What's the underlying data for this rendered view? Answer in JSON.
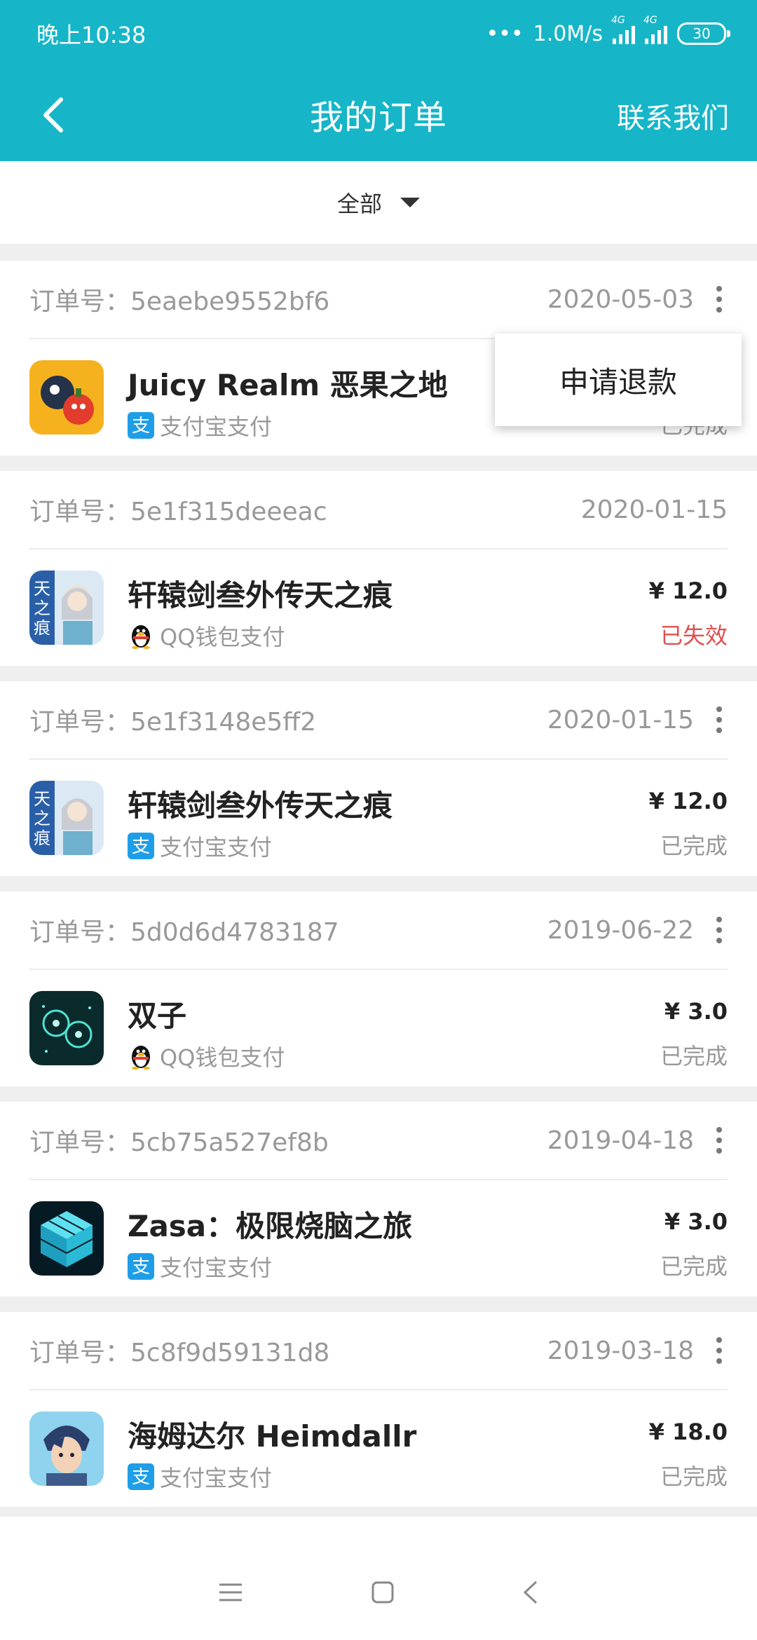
{
  "status_bar": {
    "time": "晚上10:38",
    "speed": "1.0M/s",
    "net1": "4G",
    "net2": "4G",
    "battery": "30"
  },
  "nav": {
    "title": "我的订单",
    "contact": "联系我们"
  },
  "filter": {
    "label": "全部"
  },
  "popup": {
    "label": "申请退款"
  },
  "orders": [
    {
      "order_label": "订单号：",
      "order_id": "5eaebe9552bf6",
      "date": "2020-05-03",
      "app_name": "Juicy Realm 恶果之地",
      "pay_method": "支付宝支付",
      "pay_icon": "alipay-icon",
      "price": "",
      "status": "已完成"
    },
    {
      "order_label": "订单号：",
      "order_id": "5e1f315deeeac",
      "date": "2020-01-15",
      "app_name": "轩辕剑叁外传天之痕",
      "pay_method": "QQ钱包支付",
      "pay_icon": "qq-penguin-icon",
      "price": "¥ 12.0",
      "status": "已失效"
    },
    {
      "order_label": "订单号：",
      "order_id": "5e1f3148e5ff2",
      "date": "2020-01-15",
      "app_name": "轩辕剑叁外传天之痕",
      "pay_method": "支付宝支付",
      "pay_icon": "alipay-icon",
      "price": "¥ 12.0",
      "status": "已完成"
    },
    {
      "order_label": "订单号：",
      "order_id": "5d0d6d4783187",
      "date": "2019-06-22",
      "app_name": "双子",
      "pay_method": "QQ钱包支付",
      "pay_icon": "qq-penguin-icon",
      "price": "¥ 3.0",
      "status": "已完成"
    },
    {
      "order_label": "订单号：",
      "order_id": "5cb75a527ef8b",
      "date": "2019-04-18",
      "app_name": "Zasa：极限烧脑之旅",
      "pay_method": "支付宝支付",
      "pay_icon": "alipay-icon",
      "price": "¥ 3.0",
      "status": "已完成"
    },
    {
      "order_label": "订单号：",
      "order_id": "5c8f9d59131d8",
      "date": "2019-03-18",
      "app_name": "海姆达尔 Heimdallr",
      "pay_method": "支付宝支付",
      "pay_icon": "alipay-icon",
      "price": "¥ 18.0",
      "status": "已完成"
    }
  ],
  "colors": {
    "header": "#16b6c8",
    "invalid_status": "#e0504f",
    "alipay": "#1f9ee8"
  }
}
